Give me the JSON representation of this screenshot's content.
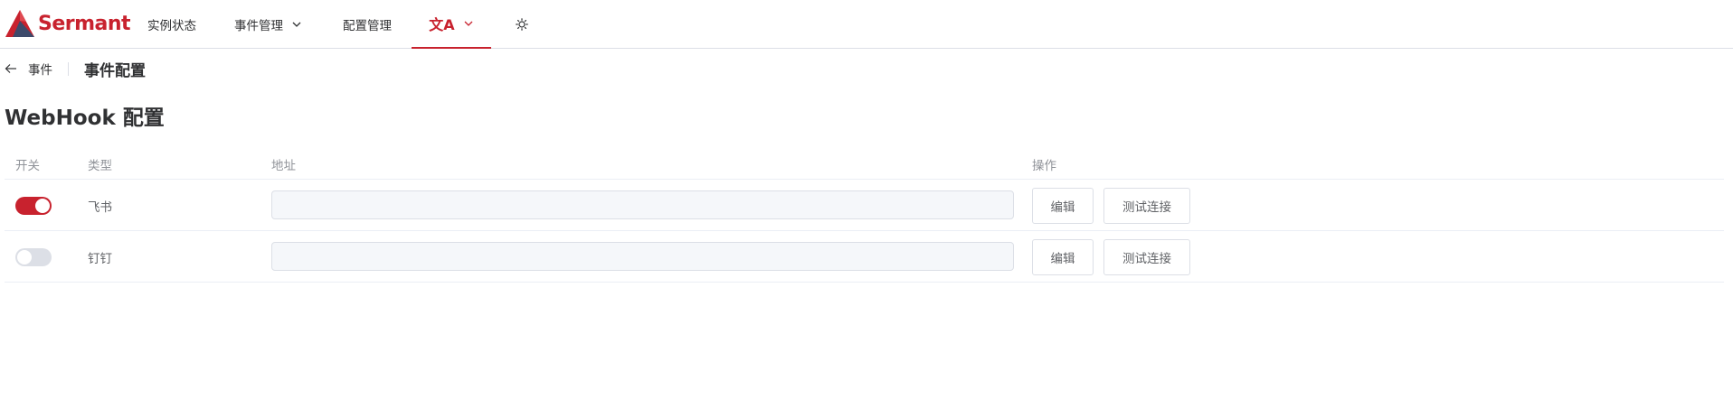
{
  "app": {
    "brand": "Sermant",
    "brand_color": "#c8222e"
  },
  "nav": {
    "items": [
      {
        "label": "实例状态"
      },
      {
        "label": "事件管理",
        "has_dropdown": true
      },
      {
        "label": "配置管理"
      }
    ],
    "language_icon": "translate-icon",
    "language_glyph": "文A",
    "theme_icon": "sun-icon"
  },
  "breadcrumb": {
    "back_label": "事件",
    "title": "事件配置"
  },
  "section": {
    "title": "WebHook 配置"
  },
  "table": {
    "headers": {
      "switch": "开关",
      "type": "类型",
      "address": "地址",
      "actions": "操作"
    },
    "rows": [
      {
        "type": "飞书",
        "enabled": true,
        "address": "",
        "edit_label": "编辑",
        "test_label": "测试连接"
      },
      {
        "type": "钉钉",
        "enabled": false,
        "address": "",
        "edit_label": "编辑",
        "test_label": "测试连接"
      }
    ]
  },
  "colors": {
    "accent": "#c8222e",
    "switch_off": "#dcdfe6",
    "input_bg": "#f5f7fa"
  }
}
